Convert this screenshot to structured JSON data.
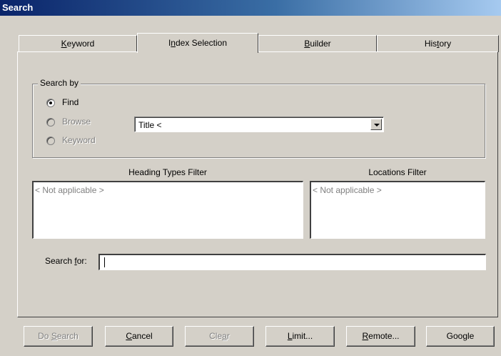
{
  "window": {
    "title": "Search"
  },
  "tabs": [
    {
      "pre": "",
      "key": "K",
      "post": "eyword"
    },
    {
      "pre": "I",
      "key": "n",
      "post": "dex Selection"
    },
    {
      "pre": "",
      "key": "B",
      "post": "uilder"
    },
    {
      "pre": "His",
      "key": "t",
      "post": "ory"
    }
  ],
  "search_by": {
    "legend": "Search by",
    "options": [
      {
        "label": "Find",
        "selected": true,
        "enabled": true
      },
      {
        "label": "Browse",
        "selected": false,
        "enabled": false
      },
      {
        "label": "Keyword",
        "selected": false,
        "enabled": false
      }
    ],
    "index_select": {
      "value": "Title <"
    }
  },
  "filters": {
    "heading_types": {
      "label": "Heading Types Filter",
      "value": "< Not applicable >"
    },
    "locations": {
      "label": "Locations Filter",
      "value": "< Not applicable >"
    }
  },
  "search_for": {
    "pre": "Search ",
    "key": "f",
    "post": "or:",
    "value": ""
  },
  "buttons": [
    {
      "pre": "Do ",
      "key": "S",
      "post": "earch",
      "enabled": false
    },
    {
      "pre": "",
      "key": "C",
      "post": "ancel",
      "enabled": true
    },
    {
      "pre": "Cle",
      "key": "a",
      "post": "r",
      "enabled": false
    },
    {
      "pre": "",
      "key": "L",
      "post": "imit...",
      "enabled": true
    },
    {
      "pre": "",
      "key": "R",
      "post": "emote...",
      "enabled": true
    },
    {
      "pre": "Google",
      "key": "",
      "post": "",
      "enabled": true
    }
  ]
}
